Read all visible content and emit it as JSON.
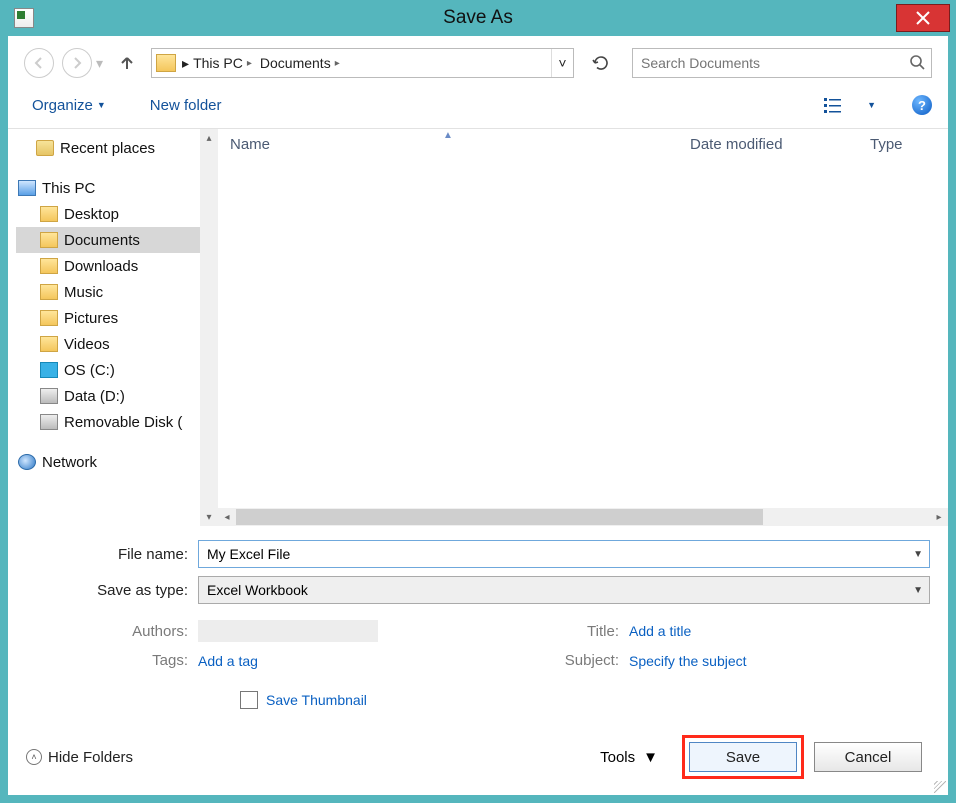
{
  "window": {
    "title": "Save As"
  },
  "breadcrumb": {
    "segments": [
      "This PC",
      "Documents"
    ]
  },
  "search": {
    "placeholder": "Search Documents"
  },
  "toolbar": {
    "organize": "Organize",
    "new_folder": "New folder"
  },
  "columns": {
    "name": "Name",
    "date": "Date modified",
    "type": "Type"
  },
  "tree": {
    "recent": "Recent places",
    "this_pc": "This PC",
    "children": [
      {
        "label": "Desktop",
        "icon": "folder"
      },
      {
        "label": "Documents",
        "icon": "folder",
        "selected": true
      },
      {
        "label": "Downloads",
        "icon": "folder"
      },
      {
        "label": "Music",
        "icon": "folder"
      },
      {
        "label": "Pictures",
        "icon": "folder"
      },
      {
        "label": "Videos",
        "icon": "folder"
      },
      {
        "label": "OS (C:)",
        "icon": "win"
      },
      {
        "label": "Data (D:)",
        "icon": "drive"
      },
      {
        "label": "Removable Disk (",
        "icon": "drive"
      }
    ],
    "network": "Network"
  },
  "form": {
    "filename_label": "File name:",
    "filename_value": "My Excel File",
    "saveastype_label": "Save as type:",
    "saveastype_value": "Excel Workbook"
  },
  "meta": {
    "authors_label": "Authors:",
    "tags_label": "Tags:",
    "tags_value": "Add a tag",
    "title_label": "Title:",
    "title_value": "Add a title",
    "subject_label": "Subject:",
    "subject_value": "Specify the subject"
  },
  "thumbnail": {
    "label": "Save Thumbnail",
    "checked": false
  },
  "bottom": {
    "hide_folders": "Hide Folders",
    "tools": "Tools",
    "save": "Save",
    "cancel": "Cancel"
  }
}
